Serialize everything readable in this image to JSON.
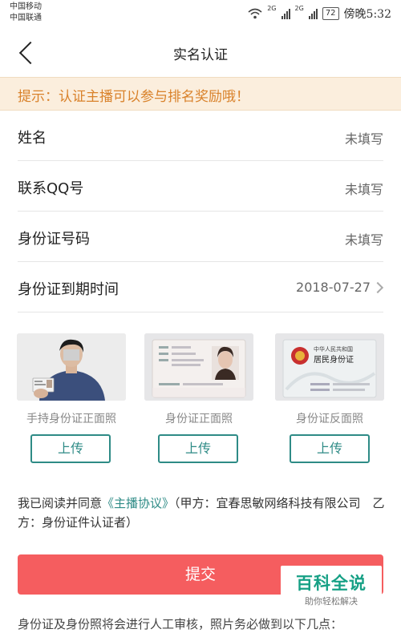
{
  "status_bar": {
    "carrier_1": "中国移动",
    "carrier_2": "中国联通",
    "net_1": "2G",
    "net_2": "2G",
    "battery": "72",
    "time": "傍晚5:32"
  },
  "nav": {
    "title": "实名认证"
  },
  "notice": {
    "text": "提示：认证主播可以参与排名奖励哦！"
  },
  "form": {
    "rows": [
      {
        "label": "姓名",
        "value": "未填写"
      },
      {
        "label": "联系QQ号",
        "value": "未填写"
      },
      {
        "label": "身份证号码",
        "value": "未填写"
      },
      {
        "label": "身份证到期时间",
        "value": "2018-07-27"
      }
    ]
  },
  "photos": [
    {
      "caption": "手持身份证正面照",
      "button": "上传"
    },
    {
      "caption": "身份证正面照",
      "button": "上传"
    },
    {
      "caption": "身份证反面照",
      "button": "上传"
    }
  ],
  "id_card_back": {
    "line1": "中华人民共和国",
    "line2": "居民身份证"
  },
  "agreement": {
    "prefix": "我已阅读并同意",
    "link": "《主播协议》",
    "suffix": "（甲方：宜春思敏网络科技有限公司　乙方：身份证件认证者）"
  },
  "submit_label": "提交",
  "footer_note": "身份证及身份照将会进行人工审核，照片务必做到以下几点：",
  "watermark": {
    "main": "百科全说",
    "sub": "助你轻松解决"
  },
  "colors": {
    "accent": "#2e8b86",
    "submit": "#f55d5f",
    "notice_text": "#d9822b",
    "notice_bg": "#fbeedd"
  }
}
